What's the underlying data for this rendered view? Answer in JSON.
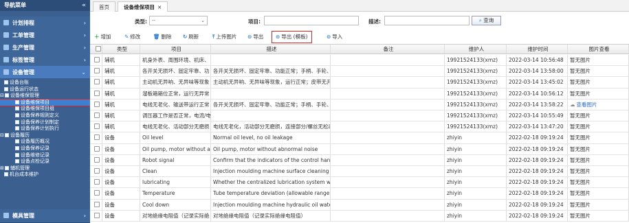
{
  "sidebar": {
    "title": "导航菜单",
    "top_items": [
      {
        "label": "计划排程"
      },
      {
        "label": "工单管理"
      },
      {
        "label": "生产管理"
      },
      {
        "label": "标签管理"
      },
      {
        "label": "设备管理"
      }
    ],
    "tree": [
      {
        "label": "设备台账",
        "level": 1
      },
      {
        "label": "设备运行状态",
        "level": 1
      },
      {
        "label": "设备维保管理",
        "level": 1,
        "expanded": true
      },
      {
        "label": "设备维保项目",
        "level": 2,
        "selected": true
      },
      {
        "label": "设备维保项目组",
        "level": 2
      },
      {
        "label": "设备保养规则定义",
        "level": 2
      },
      {
        "label": "设备保养计划制定",
        "level": 2
      },
      {
        "label": "设备保养计划执行",
        "level": 2
      },
      {
        "label": "设备履历",
        "level": 1,
        "expanded": true
      },
      {
        "label": "设备履历概况",
        "level": 2
      },
      {
        "label": "设备保养记录",
        "level": 2
      },
      {
        "label": "设备维修记录",
        "level": 2
      },
      {
        "label": "设备点检记录",
        "level": 2
      },
      {
        "label": "辅机管理",
        "level": 1
      },
      {
        "label": "机台成本维护",
        "level": 1
      }
    ],
    "bottom_item": "模具管理"
  },
  "tabs": [
    {
      "label": "首页"
    },
    {
      "label": "设备维保项目",
      "close": "×"
    }
  ],
  "filters": {
    "type_label": "类型:",
    "type_value": "--",
    "item_label": "项目:",
    "desc_label": "描述:",
    "query_button": "查询"
  },
  "toolbar": {
    "add": "增加",
    "edit": "修改",
    "delete": "删除",
    "refresh": "刷新",
    "upload": "上传图片",
    "export": "导出",
    "export_template": "导出 (模板)",
    "import": "导入"
  },
  "table": {
    "columns": [
      "类型",
      "项目",
      "描述",
      "备注",
      "维护人",
      "维护时间",
      "图片查看"
    ],
    "rows": [
      {
        "type": "辅机",
        "item": "机身外表、周围环境、机床、",
        "desc": "",
        "note": "",
        "user": "19921524133(xmz)",
        "time": "2022-03-14 10:56:48",
        "img": "暂无图片"
      },
      {
        "type": "辅机",
        "item": "各开关无损坏、固定牢靠、功",
        "desc": "各开关无损坏、固定牢靠、功能正常；手柄、手轮、操作杆",
        "note": "",
        "user": "19921524133(xmz)",
        "time": "2022-03-14 13:58:00",
        "img": "暂无图片"
      },
      {
        "type": "辅机",
        "item": "主动机无异响、无异味等现象",
        "desc": "主动机无异响、无异味等现象，运行正常；皮带无开裂、无打 123",
        "note": "",
        "user": "19921524133(xmz)",
        "time": "2022-03-14 13:45:02",
        "img": "暂无图片"
      },
      {
        "type": "辅机",
        "item": "溜板箱箱位正常，运行无异常",
        "desc": "",
        "note": "",
        "user": "19921524133(xmz)",
        "time": "2022-03-14 10:56:12",
        "img": "暂无图片"
      },
      {
        "type": "辅机",
        "item": "电线无老化、输送带运行正常",
        "desc": "各开关无损坏、固定牢靠、功能正常；手柄、手轮、操作杆",
        "note": "",
        "user": "19921524133(xmz)",
        "time": "2022-03-14 13:58:22",
        "img": "查看图片"
      },
      {
        "type": "辅机",
        "item": "调压器工作是否正常，电流/电",
        "desc": "",
        "note": "",
        "user": "19921524133(xmz)",
        "time": "2022-03-14 10:55:49",
        "img": "暂无图片"
      },
      {
        "type": "辅机",
        "item": "电线无老化、活动部分无磨损",
        "desc": "电线无老化，活动部分无磨损，连接部分/螺丝无松动，开关",
        "note": "",
        "user": "19921524133(xmz)",
        "time": "2022-03-14 13:47:20",
        "img": "暂无图片"
      },
      {
        "type": "设备",
        "item": "Oil level",
        "desc": "Normal oil level, no oil leakage",
        "note": "",
        "user": "zhiyin",
        "time": "2022-02-18 09:19:24",
        "img": "暂无图片"
      },
      {
        "type": "设备",
        "item": "Oil pump, motor without a",
        "desc": "Oil pump, motor without abnormal noise",
        "note": "",
        "user": "zhiyin",
        "time": "2022-02-18 09:19:24",
        "img": "暂无图片"
      },
      {
        "type": "设备",
        "item": "Robot signal",
        "desc": "Confirm that the indicators of the control handle are no",
        "note": "",
        "user": "zhiyin",
        "time": "2022-02-18 09:19:24",
        "img": "暂无图片"
      },
      {
        "type": "设备",
        "item": "Clean",
        "desc": "Injection moulding machine surface cleaning",
        "note": "",
        "user": "zhiyin",
        "time": "2022-02-18 09:19:24",
        "img": "暂无图片"
      },
      {
        "type": "设备",
        "item": "lubricating",
        "desc": "Whether the centralized lubrication system works norm",
        "note": "",
        "user": "zhiyin",
        "time": "2022-02-18 09:19:24",
        "img": "暂无图片"
      },
      {
        "type": "设备",
        "item": "Temperature",
        "desc": "Tube temperature deviation (allowable range ± 2 ° C)",
        "note": "",
        "user": "zhiyin",
        "time": "2022-02-18 09:19:24",
        "img": "暂无图片"
      },
      {
        "type": "设备",
        "item": "Cool down",
        "desc": "Injection moulding machine hydraulic oil water cooler,",
        "note": "",
        "user": "zhiyin",
        "time": "2022-02-18 09:19:24",
        "img": "暂无图片"
      },
      {
        "type": "设备",
        "item": "对地绝缘电阻值（记录实际绝",
        "desc": "对地绝缘电阻值（记录实际绝缘电阻值）",
        "note": "",
        "user": "zhiyin",
        "time": "2022-02-18 09:19:24",
        "img": "暂无图片"
      }
    ]
  }
}
